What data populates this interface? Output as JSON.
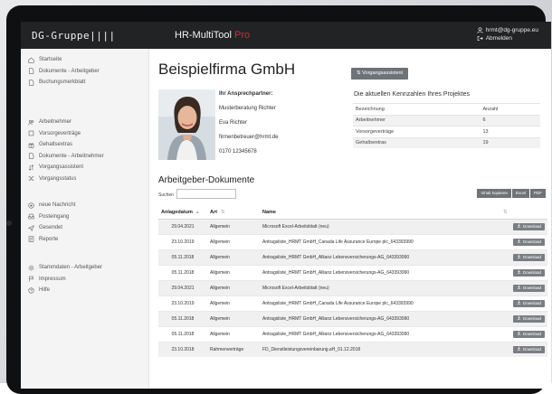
{
  "app": {
    "brand": "DG-Gruppe||||",
    "title": "HR-MultiTool",
    "title_suffix": "Pro"
  },
  "user": {
    "email": "hrmt@dg-gruppe.eu",
    "logout": "Abmelden"
  },
  "sidebar": {
    "groups": [
      {
        "items": [
          {
            "icon": "home-icon",
            "label": "Startseite"
          },
          {
            "icon": "document-icon",
            "label": "Dokumente - Arbeitgeber"
          },
          {
            "icon": "document-icon",
            "label": "Buchungsmerkblatt"
          }
        ]
      },
      {
        "items": [
          {
            "icon": "users-icon",
            "label": "Arbeitnehmer"
          },
          {
            "icon": "square-icon",
            "label": "Vorsorgeverträge"
          },
          {
            "icon": "gift-icon",
            "label": "Gehaltsextras"
          },
          {
            "icon": "document-icon",
            "label": "Dokumente - Arbeitnehmer"
          },
          {
            "icon": "sort-icon",
            "label": "Vorgangsassistent"
          },
          {
            "icon": "shuffle-icon",
            "label": "Vorgangsstatus"
          }
        ]
      },
      {
        "items": [
          {
            "icon": "plus-circle-icon",
            "label": "neue Nachricht"
          },
          {
            "icon": "inbox-icon",
            "label": "Posteingang"
          },
          {
            "icon": "send-icon",
            "label": "Gesendet"
          },
          {
            "icon": "report-icon",
            "label": "Reporte"
          }
        ]
      },
      {
        "items": [
          {
            "icon": "gear-icon",
            "label": "Stammdaten - Arbeitgeber"
          },
          {
            "icon": "flag-icon",
            "label": "Impressum"
          },
          {
            "icon": "help-icon",
            "label": "Hilfe"
          }
        ]
      }
    ]
  },
  "main": {
    "company": "Beispielfirma GmbH",
    "vorgang_button": "Vorgangsassistent",
    "contact": {
      "heading": "Ihr Ansprechpartner:",
      "firm": "Musterberatung Richter",
      "name": "Eva Richter",
      "email": "firmenbetreuer@hrmt.de",
      "phone": "0170 12345678"
    },
    "kennzahlen": {
      "title": "Die aktuellen Kennzahlen Ihres Projektes",
      "header": [
        "Bezeichnung",
        "Anzahl"
      ],
      "rows": [
        [
          "Arbeitnehmer",
          "6"
        ],
        [
          "Vorsorgeverträge",
          "13"
        ],
        [
          "Gehaltsextras",
          "19"
        ]
      ]
    },
    "documents": {
      "title": "Arbeitgeber-Dokumente",
      "search_label": "Suchen",
      "search_value": "",
      "tools": [
        "Inhalt kopieren",
        "Excel",
        "PDF"
      ],
      "columns": [
        "Anlagedatum",
        "Art",
        "Name"
      ],
      "download_label": "Download",
      "rows": [
        [
          "29.04.2021",
          "Allgemein",
          "Microsoft Excel-Arbeitsblatt (neu)"
        ],
        [
          "23.10.2019",
          "Allgemein",
          "Antragsliste_HRMT GmbH_Canada Life Assurance Europe plc_643393990"
        ],
        [
          "05.11.2018",
          "Allgemein",
          "Antragsliste_HRMT GmbH_Allianz Lebensversicherungs-AG_643393990"
        ],
        [
          "05.11.2018",
          "Allgemein",
          "Antragsliste_HRMT GmbH_Allianz Lebensversicherungs-AG_643393990"
        ],
        [
          "29.04.2021",
          "Allgemein",
          "Microsoft Excel-Arbeitsblatt (neu)"
        ],
        [
          "23.10.2019",
          "Allgemein",
          "Antragsliste_HRMT GmbH_Canada Life Assurance Europe plc_643393990"
        ],
        [
          "05.11.2018",
          "Allgemein",
          "Antragsliste_HRMT GmbH_Allianz Lebensversicherungs-AG_643393990"
        ],
        [
          "05.11.2018",
          "Allgemein",
          "Antragsliste_HRMT GmbH_Allianz Lebensversicherungs-AG_643393990"
        ],
        [
          "23.10.2018",
          "Rahmenverträge",
          "FD_Dienstleistungsvereinbarung.aH_01.12.2018"
        ]
      ]
    }
  }
}
